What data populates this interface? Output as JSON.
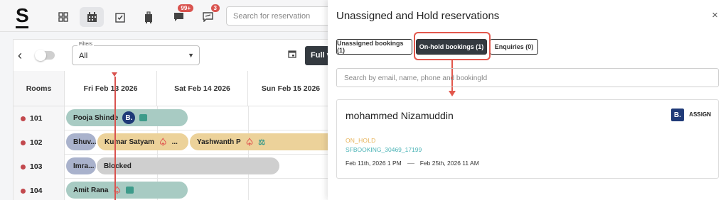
{
  "topbar": {
    "logo": "S",
    "search_placeholder": "Search for reservation",
    "badge_messages": "99+",
    "badge_notes": "3"
  },
  "toolbar": {
    "filter_label": "Filters",
    "filter_value": "All",
    "full_view_label": "Full v"
  },
  "grid": {
    "rooms_header": "Rooms",
    "dates": [
      "Fri Feb 13 2026",
      "Sat Feb 14 2026",
      "Sun Feb 15 2026"
    ],
    "rooms": [
      "101",
      "102",
      "103",
      "104"
    ],
    "bookings": {
      "b101": "Pooja Shinde",
      "b102a": "Bhuv...",
      "b102b": "Kumar Satyam",
      "b102b_more": "...",
      "b102c": "Yashwanth P",
      "b103a": "Imra...",
      "b103b": "Blocked",
      "b104": "Amit Rana"
    },
    "booking_badge": "B."
  },
  "panel": {
    "title": "Unassigned and Hold reservations",
    "close": "×",
    "tabs": [
      "Unassigned bookings (1)",
      "On-hold bookings (1)",
      "Enquiries (0)"
    ],
    "search_placeholder": "Search by email, name, phone and bookingId",
    "card": {
      "guest": "mohammed Nizamuddin",
      "source_logo": "B.",
      "assign": "ASSIGN",
      "status": "ON_HOLD",
      "reference": "SFBOOKING_30469_17199",
      "date_from": "Feb 11th, 2026 1 PM",
      "date_to": "Feb 25th, 2026 11 AM"
    }
  },
  "colors": {
    "accent_dark": "#343a40",
    "highlight": "#e2574c",
    "status_hold": "#e6b35a",
    "reference": "#4ab3b6"
  }
}
